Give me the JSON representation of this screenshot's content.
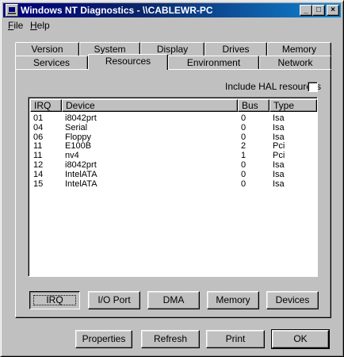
{
  "window": {
    "title": "Windows NT Diagnostics - \\\\CABLEWR-PC",
    "caption_buttons": {
      "minimize": "_",
      "maximize": "□",
      "close": "×"
    }
  },
  "menu": [
    {
      "label": "File",
      "mnemonic": "F"
    },
    {
      "label": "Help",
      "mnemonic": "H"
    }
  ],
  "tabs": {
    "back_row": [
      "Version",
      "System",
      "Display",
      "Drives",
      "Memory"
    ],
    "front_row": [
      "Services",
      "Resources",
      "Environment",
      "Network"
    ],
    "active": "Resources"
  },
  "resources": {
    "hal_label": "Include HAL resources",
    "hal_checked": false,
    "columns": [
      "IRQ",
      "Device",
      "Bus",
      "Type"
    ],
    "rows": [
      {
        "irq": "01",
        "device": "i8042prt",
        "bus": "0",
        "type": "Isa"
      },
      {
        "irq": "04",
        "device": "Serial",
        "bus": "0",
        "type": "Isa"
      },
      {
        "irq": "06",
        "device": "Floppy",
        "bus": "0",
        "type": "Isa"
      },
      {
        "irq": "11",
        "device": "E100B",
        "bus": "2",
        "type": "Pci"
      },
      {
        "irq": "11",
        "device": "nv4",
        "bus": "1",
        "type": "Pci"
      },
      {
        "irq": "12",
        "device": "i8042prt",
        "bus": "0",
        "type": "Isa"
      },
      {
        "irq": "14",
        "device": "IntelATA",
        "bus": "0",
        "type": "Isa"
      },
      {
        "irq": "15",
        "device": "IntelATA",
        "bus": "0",
        "type": "Isa"
      }
    ],
    "view_buttons": [
      "IRQ",
      "I/O Port",
      "DMA",
      "Memory",
      "Devices"
    ]
  },
  "footer_buttons": [
    "Properties",
    "Refresh",
    "Print",
    "OK"
  ]
}
